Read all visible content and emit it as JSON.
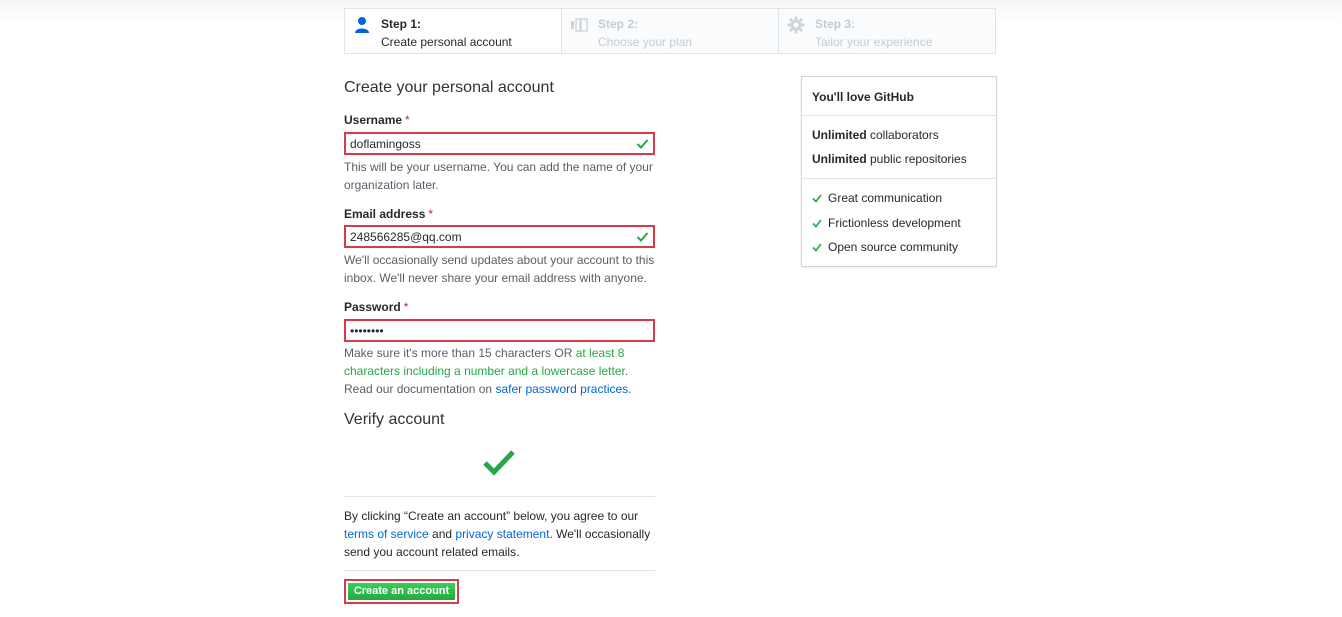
{
  "steps": [
    {
      "title": "Step 1:",
      "subtitle": "Create personal account",
      "icon": "person-icon",
      "active": true
    },
    {
      "title": "Step 2:",
      "subtitle": "Choose your plan",
      "icon": "plan-icon",
      "active": false
    },
    {
      "title": "Step 3:",
      "subtitle": "Tailor your experience",
      "icon": "gear-icon",
      "active": false
    }
  ],
  "form": {
    "title": "Create your personal account",
    "required_mark": "*",
    "username": {
      "label": "Username",
      "value": "doflamingoss",
      "help": "This will be your username. You can add the name of your organization later."
    },
    "email": {
      "label": "Email address",
      "value": "248566285@qq.com",
      "help": "We'll occasionally send updates about your account to this inbox. We'll never share your email address with anyone."
    },
    "password": {
      "label": "Password",
      "value": "••••••••",
      "help_part1": "Make sure it's more than 15 characters OR ",
      "help_green": "at least 8 characters including a number and a lowercase letter",
      "help_part2": ".",
      "help_read": "Read our documentation on ",
      "help_link": "safer password practices",
      "help_end": "."
    },
    "verify_title": "Verify account",
    "legal": {
      "text1": "By clicking “Create an account” below, you agree to our ",
      "terms_link": "terms of service",
      "text2": " and ",
      "privacy_link": "privacy statement",
      "text3": ". We'll occasionally send you account related emails."
    },
    "submit_label": "Create an account"
  },
  "sidebar": {
    "title": "You'll love GitHub",
    "features": [
      {
        "bold": "Unlimited",
        "rest": " collaborators"
      },
      {
        "bold": "Unlimited",
        "rest": " public repositories"
      }
    ],
    "checks": [
      "Great communication",
      "Frictionless development",
      "Open source community"
    ]
  },
  "colors": {
    "accent_green": "#28a745",
    "error_red": "#d73a49",
    "link_blue": "#0366d6"
  }
}
